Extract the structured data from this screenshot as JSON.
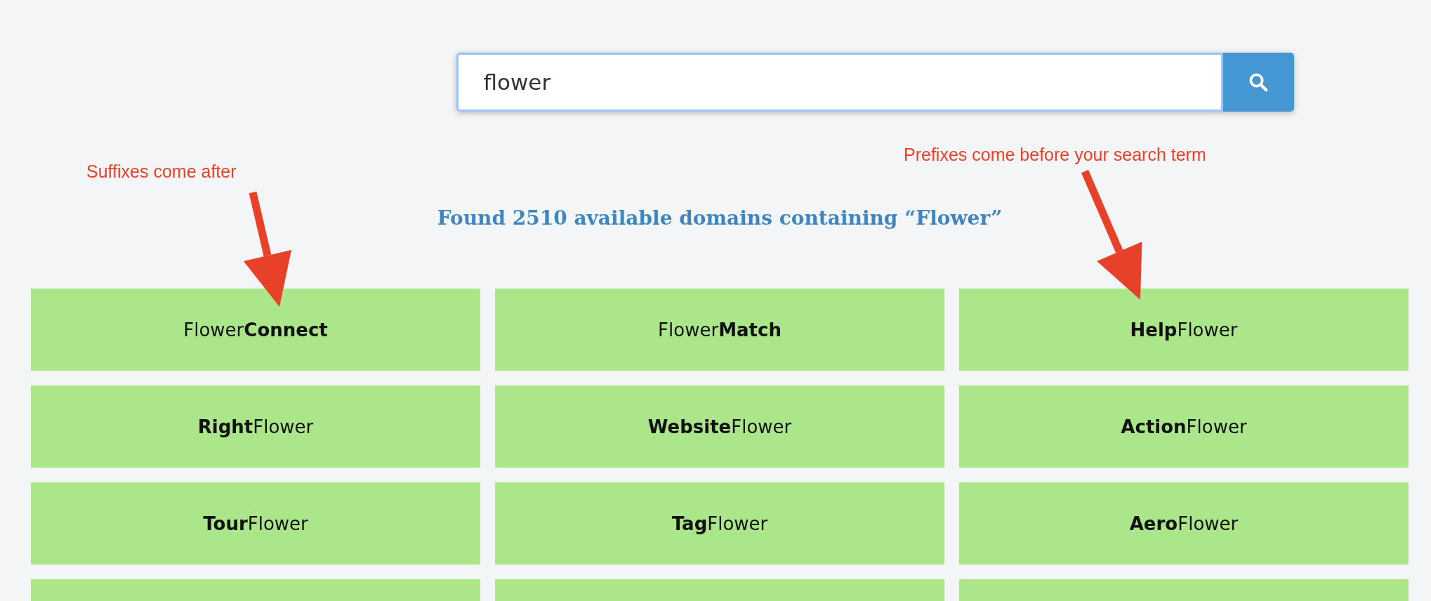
{
  "search": {
    "value": "flower"
  },
  "annotations": [
    "Suffixes come after",
    "Prefixes come before your search term"
  ],
  "heading": "Found 2510 available domains containing “Flower”",
  "domains": [
    {
      "kind": "name",
      "label": "Flower**Connect**"
    },
    {
      "kind": "name",
      "label": "Flower**Match**"
    },
    {
      "kind": "name",
      "label": "**Help**Flower"
    },
    {
      "kind": "name",
      "label": "**Right**Flower"
    },
    {
      "kind": "name",
      "label": "**Website**Flower"
    },
    {
      "kind": "name",
      "label": "**Action**Flower"
    },
    {
      "kind": "name",
      "label": "**Tour**Flower"
    },
    {
      "kind": "name",
      "label": "**Tag**Flower"
    },
    {
      "kind": "name",
      "label": "**Aero**Flower"
    },
    {
      "kind": "blank"
    },
    {
      "kind": "blank"
    },
    {
      "kind": "blank"
    }
  ]
}
